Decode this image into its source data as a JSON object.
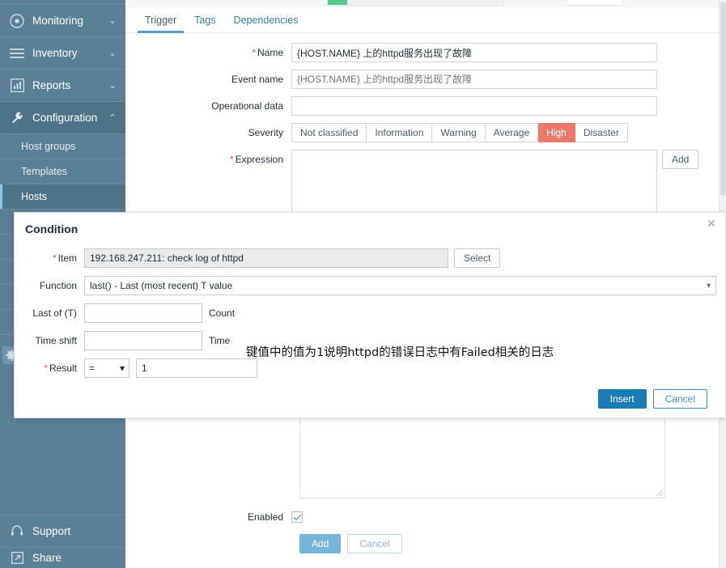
{
  "sidebar": {
    "items": [
      {
        "label": "Monitoring",
        "icon": "eye-icon",
        "chevron": "⌄",
        "active": false
      },
      {
        "label": "Inventory",
        "icon": "list-icon",
        "chevron": "⌄",
        "active": false
      },
      {
        "label": "Reports",
        "icon": "bar-chart-icon",
        "chevron": "⌄",
        "active": false
      },
      {
        "label": "Configuration",
        "icon": "wrench-icon",
        "chevron": "⌃",
        "active": true
      }
    ],
    "subitems": [
      {
        "label": "Host groups",
        "active": false
      },
      {
        "label": "Templates",
        "active": false
      },
      {
        "label": "Hosts",
        "active": true
      }
    ],
    "admin_icon": "gear-icon",
    "bottom": [
      {
        "label": "Support",
        "icon": "headset-icon"
      },
      {
        "label": "Share",
        "icon": "share-icon"
      }
    ]
  },
  "tabs": [
    {
      "label": "Trigger",
      "active": true
    },
    {
      "label": "Tags",
      "active": false
    },
    {
      "label": "Dependencies",
      "active": false
    }
  ],
  "trigger_form": {
    "name_label": "Name",
    "name_value": "{HOST.NAME} 上的httpd服务出现了故障",
    "event_name_label": "Event name",
    "event_name_placeholder": "{HOST.NAME} 上的httpd服务出现了故障",
    "event_name_value": "",
    "operational_data_label": "Operational data",
    "operational_data_value": "",
    "severity_label": "Severity",
    "severity_options": [
      {
        "label": "Not classified",
        "selected": false
      },
      {
        "label": "Information",
        "selected": false
      },
      {
        "label": "Warning",
        "selected": false
      },
      {
        "label": "Average",
        "selected": false
      },
      {
        "label": "High",
        "selected": true
      },
      {
        "label": "Disaster",
        "selected": false
      }
    ],
    "expression_label": "Expression",
    "expression_value": "",
    "expression_add_label": "Add",
    "enabled_label": "Enabled",
    "enabled_checked": true,
    "submit_label": "Add",
    "cancel_label": "Cancel"
  },
  "progress": {
    "percent": 11,
    "fill_color": "#59ca8f"
  },
  "modal": {
    "title": "Condition",
    "close_icon": "close-icon",
    "item_label": "Item",
    "item_value": "192.168.247.211: check log of httpd",
    "select_label": "Select",
    "function_label": "Function",
    "function_value": "last() - Last (most recent) T value",
    "last_of_t_label": "Last of (T)",
    "last_of_t_value": "",
    "last_of_t_unit": "Count",
    "time_shift_label": "Time shift",
    "time_shift_value": "",
    "time_shift_unit": "Time",
    "result_label": "Result",
    "result_operator": "=",
    "result_value": "1",
    "insert_label": "Insert",
    "cancel_label": "Cancel",
    "annotation": "键值中的值为1说明httpd的错误日志中有Failed相关的日志"
  },
  "colors": {
    "sidebar_bg": "#5b7f95",
    "accent_blue": "#1a7bb5",
    "severity_high": "#e9786b",
    "tab_active_underline": "#5a9fcb"
  }
}
